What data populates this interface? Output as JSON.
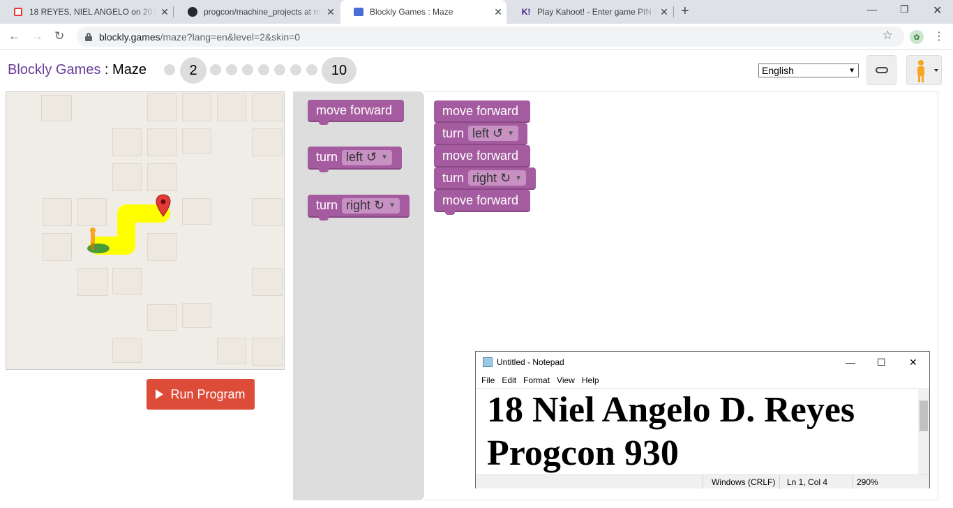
{
  "browser": {
    "tabs": [
      {
        "title": "18 REYES, NIEL ANGELO on 2019",
        "icon": "classroom-icon"
      },
      {
        "title": "progcon/machine_projects at ma",
        "icon": "github-icon"
      },
      {
        "title": "Blockly Games : Maze",
        "icon": "blockly-icon"
      },
      {
        "title": "Play Kahoot! - Enter game PIN he",
        "icon": "kahoot-icon"
      }
    ],
    "url_host": "blockly.games",
    "url_path": "/maze?lang=en&level=2&skin=0"
  },
  "header": {
    "app_name": "Blockly Games",
    "separator": " : ",
    "game_name": "Maze",
    "levels": [
      "2",
      "10"
    ],
    "current_level": "2",
    "language": "English"
  },
  "toolbox": [
    {
      "type": "move",
      "label": "move forward"
    },
    {
      "type": "turn",
      "label": "turn",
      "option": "left ↺"
    },
    {
      "type": "turn",
      "label": "turn",
      "option": "right ↻"
    }
  ],
  "program": [
    {
      "label": "move forward"
    },
    {
      "label": "turn",
      "option": "left ↺"
    },
    {
      "label": "move forward"
    },
    {
      "label": "turn",
      "option": "right ↻"
    },
    {
      "label": "move forward"
    }
  ],
  "run_button": {
    "label": "Run Program"
  },
  "notepad": {
    "title": "Untitled - Notepad",
    "menu": [
      "File",
      "Edit",
      "Format",
      "View",
      "Help"
    ],
    "line1": "18 Niel Angelo D. Reyes",
    "line2": "Progcon 930",
    "status_encoding": "Windows (CRLF)",
    "status_position": "Ln 1, Col 4",
    "status_zoom": "290%"
  },
  "colors": {
    "block_purple": "#a55b9f",
    "run_red": "#dd4b39",
    "path_yellow": "#ffff00",
    "header_purple": "#6a3d9a"
  }
}
